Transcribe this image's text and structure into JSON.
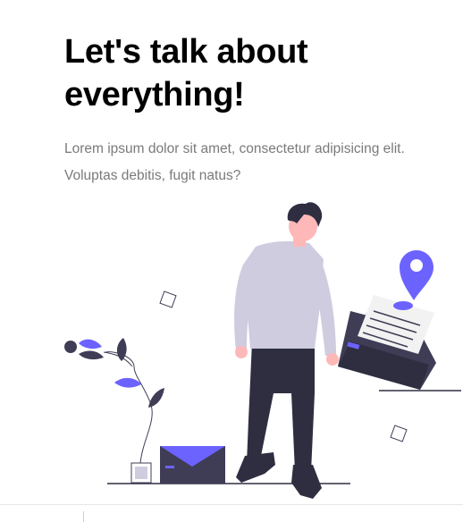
{
  "hero": {
    "title_line1": "Let's talk about",
    "title_line2": "everything!",
    "description": "Lorem ipsum dolor sit amet, consectetur adipisicing elit. Voluptas debitis, fugit natus?"
  },
  "colors": {
    "accent": "#6c63ff",
    "dark": "#2f2e41",
    "shirt": "#cfcce0",
    "skin": "#ffb8b8",
    "text_muted": "#7a7a7a"
  },
  "icons": [
    "plant-icon",
    "envelope-icon",
    "location-pin-icon",
    "person-illustration",
    "open-envelope-icon"
  ]
}
